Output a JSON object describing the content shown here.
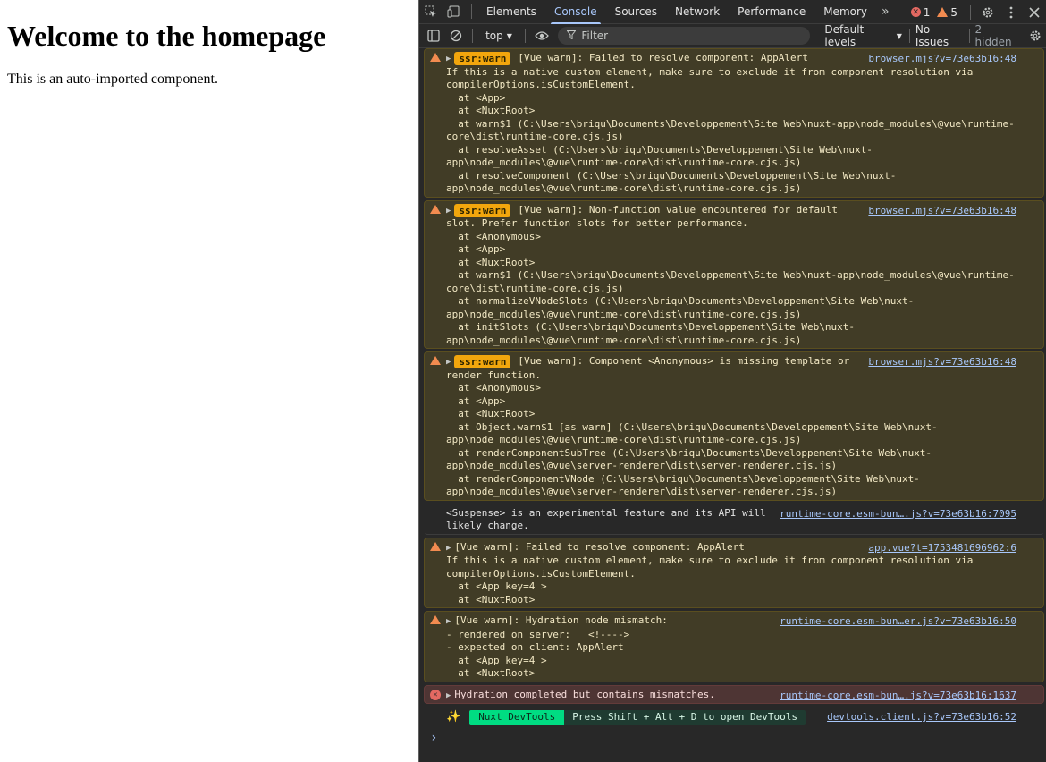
{
  "page": {
    "heading": "Welcome to the homepage",
    "paragraph": "This is an auto-imported component."
  },
  "devtools": {
    "tabs": [
      {
        "label": "Elements"
      },
      {
        "label": "Console",
        "active": true
      },
      {
        "label": "Sources"
      },
      {
        "label": "Network"
      },
      {
        "label": "Performance"
      },
      {
        "label": "Memory"
      }
    ],
    "more_tabs_icon": "»",
    "error_count": "1",
    "warning_count": "5",
    "toolbar": {
      "context": "top",
      "filter_placeholder": "Filter",
      "levels": "Default levels",
      "issues": "No Issues",
      "hidden": "2 hidden"
    },
    "colors": {
      "warn_bg": "#413c26",
      "error_bg": "#4e3534",
      "accent": "#a8c7fa",
      "nuxt_green": "#00dc82",
      "ssr_pill": "#f2a60d"
    }
  },
  "console": {
    "messages": [
      {
        "level": "warn",
        "pill": "ssr:warn",
        "head": "[Vue warn]: Failed to resolve component: AppAlert",
        "body": "If this is a native custom element, make sure to exclude it from component resolution via\ncompilerOptions.isCustomElement.\n  at <App>\n  at <NuxtRoot>\n  at warn$1 (C:\\Users\\briqu\\Documents\\Developpement\\Site Web\\nuxt-app\\node_modules\\@vue\\runtime-\ncore\\dist\\runtime-core.cjs.js)\n  at resolveAsset (C:\\Users\\briqu\\Documents\\Developpement\\Site Web\\nuxt-\napp\\node_modules\\@vue\\runtime-core\\dist\\runtime-core.cjs.js)\n  at resolveComponent (C:\\Users\\briqu\\Documents\\Developpement\\Site Web\\nuxt-\napp\\node_modules\\@vue\\runtime-core\\dist\\runtime-core.cjs.js)",
        "source": "browser.mjs?v=73e63b16:48"
      },
      {
        "level": "warn",
        "pill": "ssr:warn",
        "head": "[Vue warn]: Non-function value encountered for default",
        "body": "slot. Prefer function slots for better performance.\n  at <Anonymous>\n  at <App>\n  at <NuxtRoot>\n  at warn$1 (C:\\Users\\briqu\\Documents\\Developpement\\Site Web\\nuxt-app\\node_modules\\@vue\\runtime-\ncore\\dist\\runtime-core.cjs.js)\n  at normalizeVNodeSlots (C:\\Users\\briqu\\Documents\\Developpement\\Site Web\\nuxt-\napp\\node_modules\\@vue\\runtime-core\\dist\\runtime-core.cjs.js)\n  at initSlots (C:\\Users\\briqu\\Documents\\Developpement\\Site Web\\nuxt-\napp\\node_modules\\@vue\\runtime-core\\dist\\runtime-core.cjs.js)",
        "source": "browser.mjs?v=73e63b16:48"
      },
      {
        "level": "warn",
        "pill": "ssr:warn",
        "head": "[Vue warn]: Component <Anonymous> is missing template or",
        "body": "render function.\n  at <Anonymous>\n  at <App>\n  at <NuxtRoot>\n  at Object.warn$1 [as warn] (C:\\Users\\briqu\\Documents\\Developpement\\Site Web\\nuxt-\napp\\node_modules\\@vue\\runtime-core\\dist\\runtime-core.cjs.js)\n  at renderComponentSubTree (C:\\Users\\briqu\\Documents\\Developpement\\Site Web\\nuxt-\napp\\node_modules\\@vue\\server-renderer\\dist\\server-renderer.cjs.js)\n  at renderComponentVNode (C:\\Users\\briqu\\Documents\\Developpement\\Site Web\\nuxt-\napp\\node_modules\\@vue\\server-renderer\\dist\\server-renderer.cjs.js)",
        "source": "browser.mjs?v=73e63b16:48"
      },
      {
        "level": "info",
        "head": "<Suspense> is an experimental feature and its API will",
        "body": "likely change.",
        "source": "runtime-core.esm-bun….js?v=73e63b16:7095"
      },
      {
        "level": "warn",
        "head": "[Vue warn]: Failed to resolve component: AppAlert",
        "body": "If this is a native custom element, make sure to exclude it from component resolution via\ncompilerOptions.isCustomElement.\n  at <App key=4 >\n  at <NuxtRoot>",
        "source": "app.vue?t=1753481696962:6"
      },
      {
        "level": "warn",
        "head": "[Vue warn]: Hydration node mismatch:",
        "body": "- rendered on server:   <!---->\n- expected on client: AppAlert\n  at <App key=4 >\n  at <NuxtRoot>",
        "source": "runtime-core.esm-bun…er.js?v=73e63b16:50"
      },
      {
        "level": "error",
        "head": "Hydration completed but contains mismatches.",
        "body": "",
        "source": "runtime-core.esm-bun….js?v=73e63b16:1637"
      }
    ],
    "nuxt": {
      "icon": "✨",
      "label": "Nuxt DevTools",
      "hint": "Press Shift + Alt + D to open DevTools",
      "source": "devtools.client.js?v=73e63b16:52"
    },
    "prompt": "›"
  }
}
